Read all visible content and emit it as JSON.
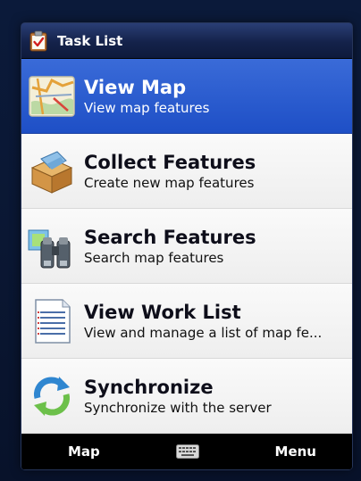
{
  "titlebar": {
    "title": "Task List",
    "icon": "clipboard-check-icon"
  },
  "tasks": [
    {
      "label": "View Map",
      "subtitle": "View map features",
      "icon": "map-icon",
      "selected": true
    },
    {
      "label": "Collect Features",
      "subtitle": "Create new map features",
      "icon": "box-icon",
      "selected": false
    },
    {
      "label": "Search Features",
      "subtitle": "Search map features",
      "icon": "binoculars-icon",
      "selected": false
    },
    {
      "label": "View Work List",
      "subtitle": "View and manage a list of map fe...",
      "icon": "document-list-icon",
      "selected": false
    },
    {
      "label": "Synchronize",
      "subtitle": "Synchronize with the server",
      "icon": "sync-icon",
      "selected": false
    }
  ],
  "softkeys": {
    "left": "Map",
    "center_icon": "keyboard-icon",
    "right": "Menu"
  },
  "colors": {
    "selection": "#2556cc",
    "titlebar": "#1a2b5a",
    "softbar": "#000000"
  }
}
